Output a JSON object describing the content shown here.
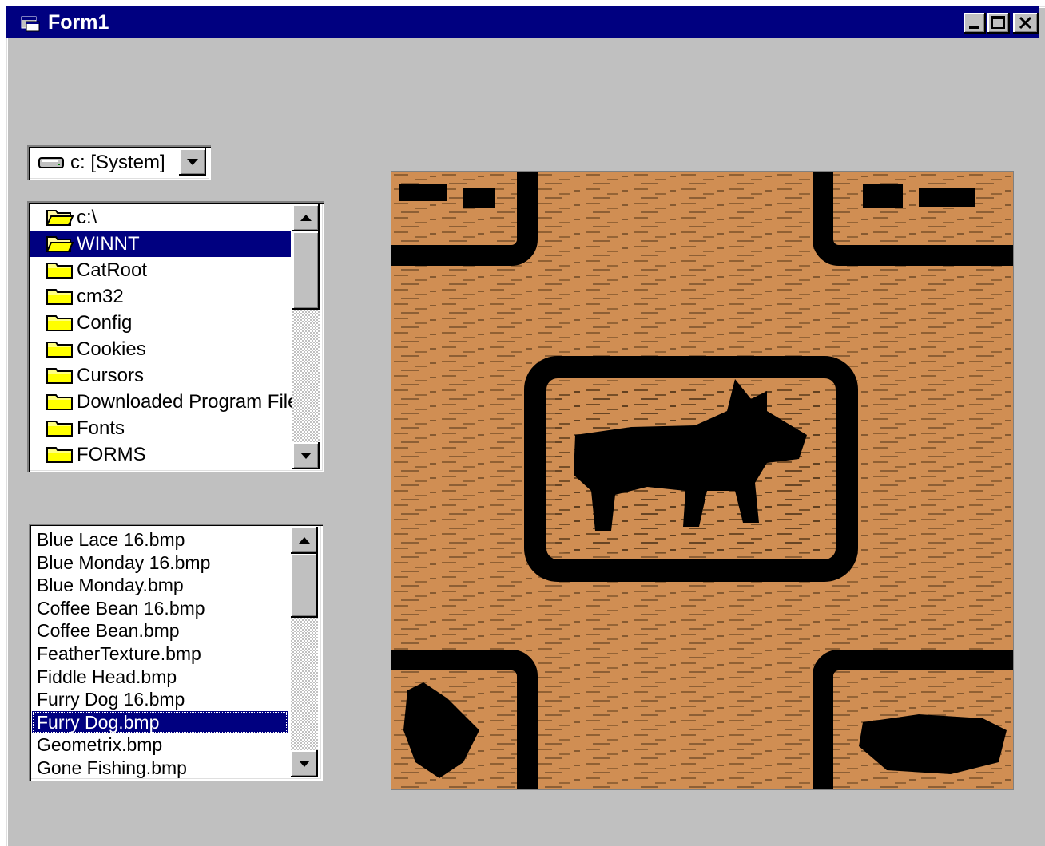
{
  "window": {
    "title": "Form1",
    "minimize_symbol": "_",
    "maximize_symbol": "□",
    "close_symbol": "×"
  },
  "drive": {
    "label": "c: [System]",
    "icon": "drive-icon"
  },
  "directory_list": {
    "items": [
      {
        "label": "c:\\",
        "icon": "open-folder-icon",
        "selected": false
      },
      {
        "label": "WINNT",
        "icon": "open-folder-icon",
        "selected": true
      },
      {
        "label": "CatRoot",
        "icon": "folder-icon",
        "selected": false
      },
      {
        "label": "cm32",
        "icon": "folder-icon",
        "selected": false
      },
      {
        "label": "Config",
        "icon": "folder-icon",
        "selected": false
      },
      {
        "label": "Cookies",
        "icon": "folder-icon",
        "selected": false
      },
      {
        "label": "Cursors",
        "icon": "folder-icon",
        "selected": false
      },
      {
        "label": "Downloaded Program File",
        "icon": "folder-icon",
        "selected": false
      },
      {
        "label": "Fonts",
        "icon": "folder-icon",
        "selected": false
      },
      {
        "label": "FORMS",
        "icon": "folder-icon",
        "selected": false
      }
    ]
  },
  "file_list": {
    "items": [
      {
        "label": "Blue Lace 16.bmp",
        "selected": false
      },
      {
        "label": "Blue Monday 16.bmp",
        "selected": false
      },
      {
        "label": "Blue Monday.bmp",
        "selected": false
      },
      {
        "label": "Coffee Bean 16.bmp",
        "selected": false
      },
      {
        "label": "Coffee Bean.bmp",
        "selected": false
      },
      {
        "label": "FeatherTexture.bmp",
        "selected": false
      },
      {
        "label": "Fiddle Head.bmp",
        "selected": false
      },
      {
        "label": "Furry Dog 16.bmp",
        "selected": false
      },
      {
        "label": "Furry Dog.bmp",
        "selected": true
      },
      {
        "label": "Geometrix.bmp",
        "selected": false
      },
      {
        "label": "Gone Fishing.bmp",
        "selected": false
      }
    ]
  },
  "picture": {
    "content": "furry-dog-tile-image",
    "colors": {
      "background": "#d08e53",
      "ink": "#000000"
    }
  },
  "colors": {
    "face": "#c0c0c0",
    "title_bar": "#000080",
    "selection": "#000080"
  }
}
